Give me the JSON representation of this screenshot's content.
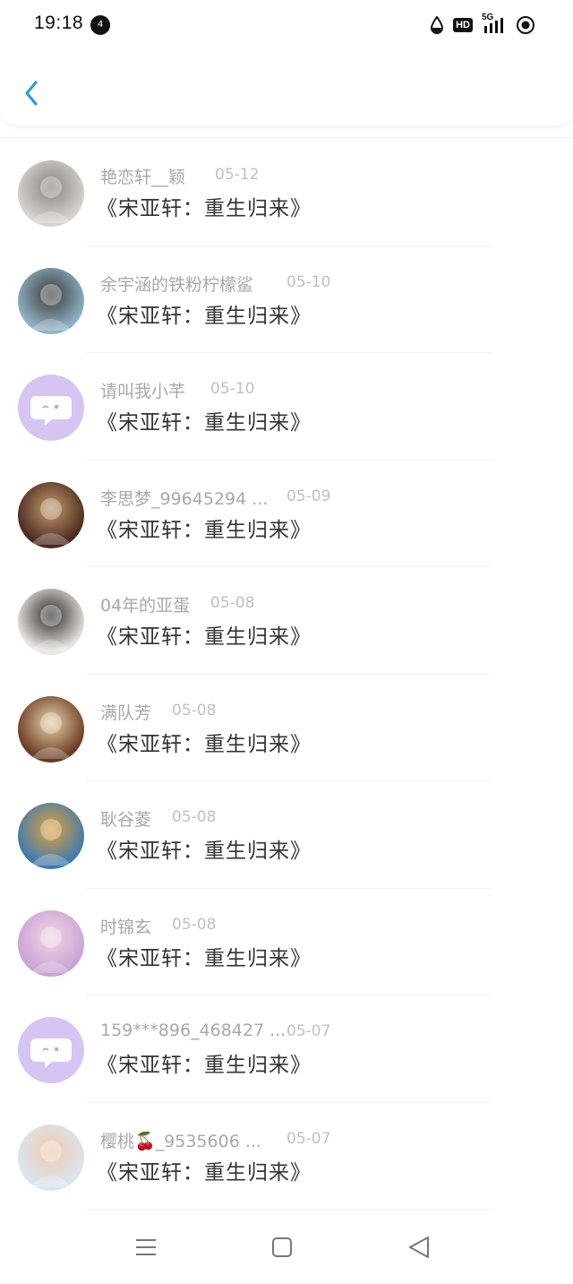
{
  "status_bar": {
    "time": "19:18",
    "notification_badge": "4",
    "hd_label": "HD",
    "network_label": "5G"
  },
  "header": {
    "back_icon": "chevron-left-icon",
    "accent_color": "#2f9ad8"
  },
  "list": {
    "items": [
      {
        "name": "艳恋轩__颖",
        "date": "05-12",
        "title": "《宋亚轩：重生归来》",
        "avatar": "photo-avatar"
      },
      {
        "name": "余宇涵的铁粉柠檬鲨",
        "date": "05-10",
        "title": "《宋亚轩：重生归来》",
        "avatar": "photo-avatar"
      },
      {
        "name": "请叫我小芊",
        "date": "05-10",
        "title": "《宋亚轩：重生归来》",
        "avatar": "default-chat-avatar"
      },
      {
        "name": "李思梦_99645294 ...",
        "date": "05-09",
        "title": "《宋亚轩：重生归来》",
        "avatar": "photo-avatar"
      },
      {
        "name": "04年的亚蛋",
        "date": "05-08",
        "title": "《宋亚轩：重生归来》",
        "avatar": "photo-avatar"
      },
      {
        "name": "满队芳",
        "date": "05-08",
        "title": "《宋亚轩：重生归来》",
        "avatar": "photo-avatar"
      },
      {
        "name": "耿谷菱",
        "date": "05-08",
        "title": "《宋亚轩：重生归来》",
        "avatar": "photo-avatar"
      },
      {
        "name": "时锦玄",
        "date": "05-08",
        "title": "《宋亚轩：重生归来》",
        "avatar": "photo-avatar"
      },
      {
        "name": "159***896_468427 ...",
        "date": "05-07",
        "title": "《宋亚轩：重生归来》",
        "avatar": "default-chat-avatar"
      },
      {
        "name": "樱桃🍒_9535606 ...",
        "date": "05-07",
        "title": "《宋亚轩：重生归来》",
        "avatar": "photo-avatar"
      }
    ]
  },
  "nav_bar": {
    "menu_icon": "menu-icon",
    "home_icon": "home-square-icon",
    "back_icon": "back-triangle-icon"
  }
}
